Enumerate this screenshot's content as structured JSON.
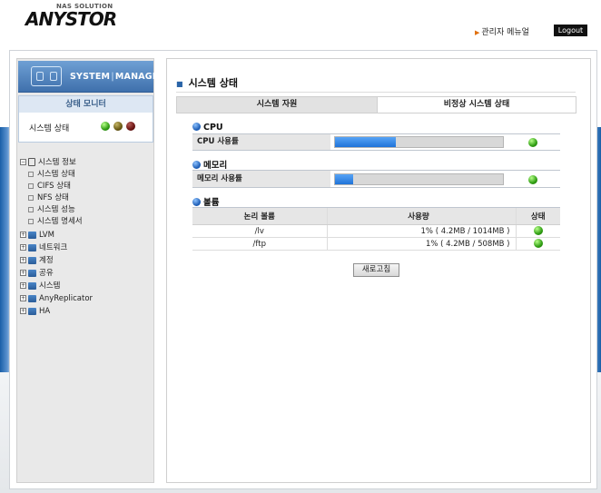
{
  "header": {
    "logo_sub": "NAS SOLUTION",
    "logo_main": "ANYSTOR",
    "admin_menu": "관리자 메뉴얼",
    "logout": "Logout"
  },
  "sidebar": {
    "banner_title_a": "SYSTEM",
    "banner_sep": "|",
    "banner_title_b": "MANAGER",
    "monitor_title": "상태 모니터",
    "monitor_label": "시스템 상태",
    "status_lights": [
      "green",
      "olive",
      "maroon"
    ],
    "tree": {
      "system_info": "시스템 정보",
      "children": [
        "시스템 상태",
        "CIFS 상태",
        "NFS 상태",
        "시스템 성능",
        "시스템 명세서"
      ],
      "groups": [
        "LVM",
        "네트워크",
        "계정",
        "공유",
        "시스템",
        "AnyReplicator",
        "HA"
      ]
    }
  },
  "main": {
    "title": "시스템 상태",
    "tabs": [
      "시스템 자원",
      "비정상 시스템 상태"
    ],
    "cpu": {
      "section": "CPU",
      "label": "CPU 사용률",
      "usage_fraction": 0.36,
      "status": "green"
    },
    "memory": {
      "section": "메모리",
      "label": "메모리 사용률",
      "usage_fraction": 0.11,
      "status": "green"
    },
    "volume": {
      "section": "볼륨",
      "headers": [
        "논리 볼륨",
        "사용량",
        "상태"
      ],
      "rows": [
        {
          "name": "/lv",
          "usage": "1% ( 4.2MB / 1014MB )",
          "status": "green"
        },
        {
          "name": "/ftp",
          "usage": "1% ( 4.2MB / 508MB )",
          "status": "green"
        }
      ]
    },
    "refresh": "새로고침"
  }
}
